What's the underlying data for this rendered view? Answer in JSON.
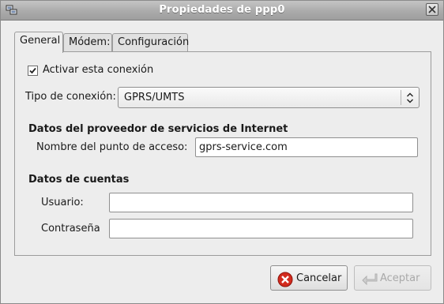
{
  "window": {
    "title": "Propiedades de ppp0"
  },
  "tabs": [
    {
      "label": "General"
    },
    {
      "label": "Módem:"
    },
    {
      "label": "Configuración"
    }
  ],
  "general": {
    "activate": {
      "label": "Activar esta conexión",
      "checked": true
    },
    "connection_type": {
      "label": "Tipo de conexión:",
      "value": "GPRS/UMTS"
    },
    "isp": {
      "heading": "Datos del proveedor de servicios de Internet",
      "apn_label": "Nombre del punto de acceso:",
      "apn_value": "gprs-service.com"
    },
    "account": {
      "heading": "Datos de cuentas",
      "user_label": "Usuario:",
      "user_value": "",
      "password_label": "Contraseña",
      "password_value": ""
    }
  },
  "buttons": {
    "cancel": {
      "label": "Cancelar",
      "icon": "cancel-icon"
    },
    "accept": {
      "label": "Aceptar",
      "icon": "back-arrow-icon",
      "enabled": false
    }
  }
}
